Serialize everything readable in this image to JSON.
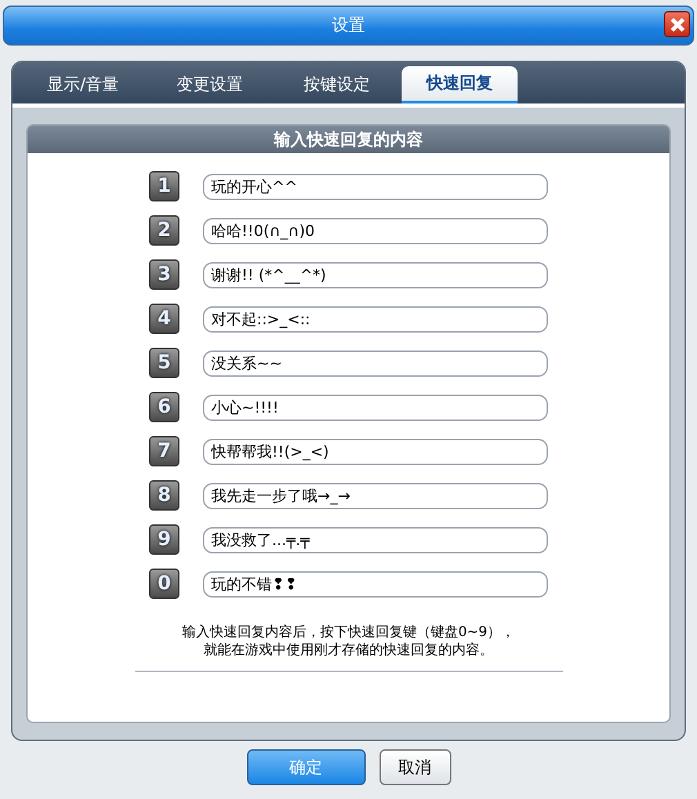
{
  "window": {
    "title": "设置"
  },
  "tabs": [
    {
      "label": "显示/音量",
      "selected": false
    },
    {
      "label": "变更设置",
      "selected": false
    },
    {
      "label": "按键设定",
      "selected": false
    },
    {
      "label": "快速回复",
      "selected": true
    }
  ],
  "section": {
    "title": "输入快速回复的内容"
  },
  "replies": [
    {
      "key": "1",
      "value": "玩的开心^^"
    },
    {
      "key": "2",
      "value": "哈哈!!0(∩_∩)0"
    },
    {
      "key": "3",
      "value": "谢谢!! (*^__^*)"
    },
    {
      "key": "4",
      "value": "对不起::>_<::"
    },
    {
      "key": "5",
      "value": "没关系~~"
    },
    {
      "key": "6",
      "value": "小心~!!!!"
    },
    {
      "key": "7",
      "value": "快帮帮我!!(>_<)"
    },
    {
      "key": "8",
      "value": "我先走一步了哦→_→"
    },
    {
      "key": "9",
      "value": "我没救了...╤.╤"
    },
    {
      "key": "0",
      "value": "玩的不错❢❢"
    }
  ],
  "hint": [
    "输入快速回复内容后，按下快速回复键（键盘0~9），",
    "就能在游戏中使用刚才存储的快速回复的内容。"
  ],
  "buttons": [
    {
      "label": "确定",
      "kind": "primary"
    },
    {
      "label": "取消",
      "kind": "secondary"
    }
  ]
}
